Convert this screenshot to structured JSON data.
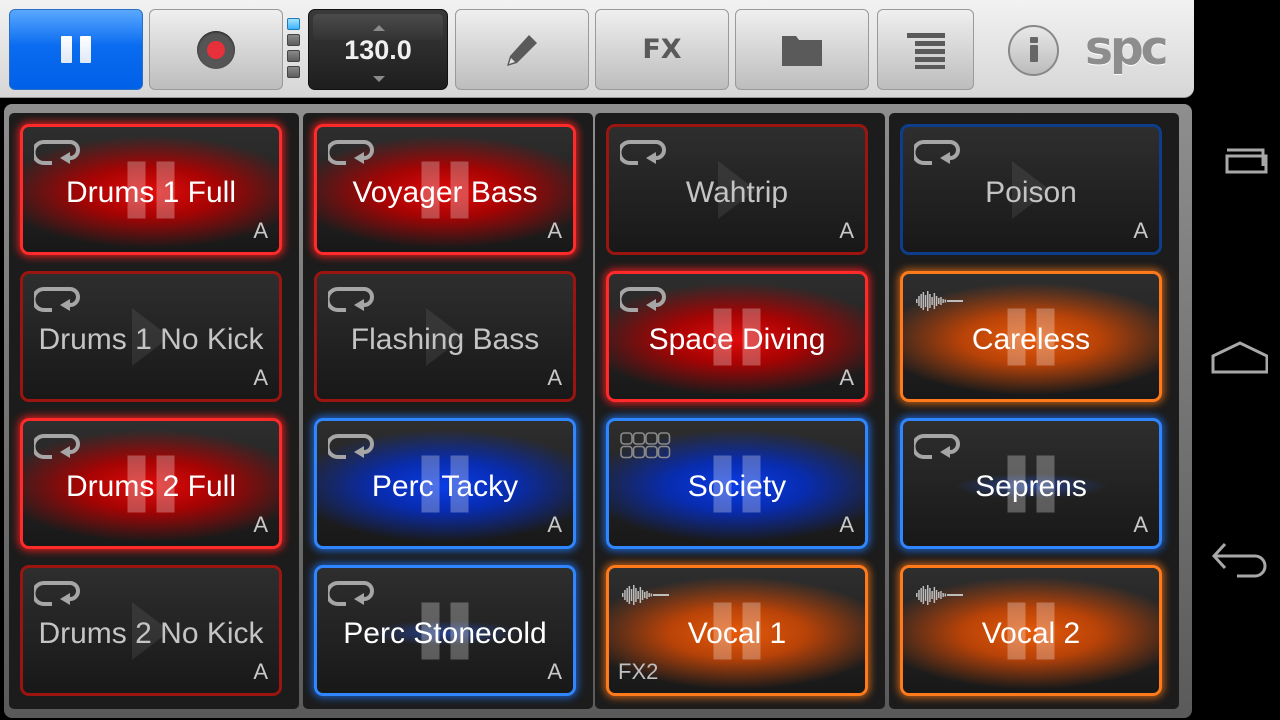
{
  "toolbar": {
    "play_pause": {
      "icon": "pause-icon",
      "state": "playing"
    },
    "record": {
      "icon": "record-icon"
    },
    "banks": [
      {
        "label": "bank-1",
        "active": true
      },
      {
        "label": "bank-2",
        "active": false
      },
      {
        "label": "bank-3",
        "active": false
      },
      {
        "label": "bank-4",
        "active": false
      }
    ],
    "tempo": "130.0",
    "edit": {
      "icon": "pencil-icon"
    },
    "fx_label": "FX",
    "folder": {
      "icon": "folder-icon"
    },
    "menu": {
      "icon": "list-menu-icon"
    },
    "info": {
      "icon": "info-icon"
    },
    "logo": "spc"
  },
  "colors": {
    "red": "#ff2a2a",
    "blue": "#2f86ff",
    "orange": "#ff7a1a",
    "play_button": "#0a6cf0"
  },
  "columns": [
    {
      "pads": [
        {
          "name": "Drums 1 Full",
          "tag": "A",
          "mode": "loop",
          "state": "playing",
          "color": "red"
        },
        {
          "name": "Drums 1 No Kick",
          "tag": "A",
          "mode": "loop",
          "state": "stopped",
          "color": "red"
        },
        {
          "name": "Drums 2 Full",
          "tag": "A",
          "mode": "loop",
          "state": "playing",
          "color": "red"
        },
        {
          "name": "Drums 2 No Kick",
          "tag": "A",
          "mode": "loop",
          "state": "stopped",
          "color": "red"
        }
      ]
    },
    {
      "pads": [
        {
          "name": "Voyager Bass",
          "tag": "A",
          "mode": "loop",
          "state": "playing",
          "color": "red"
        },
        {
          "name": "Flashing Bass",
          "tag": "A",
          "mode": "loop",
          "state": "stopped",
          "color": "red"
        },
        {
          "name": "Perc Tacky",
          "tag": "A",
          "mode": "loop",
          "state": "playing",
          "color": "blue"
        },
        {
          "name": "Perc Stonecold",
          "tag": "A",
          "mode": "loop",
          "state": "playing-dim",
          "color": "blue"
        }
      ]
    },
    {
      "pads": [
        {
          "name": "Wahtrip",
          "tag": "A",
          "mode": "loop",
          "state": "stopped",
          "color": "red"
        },
        {
          "name": "Space Diving",
          "tag": "A",
          "mode": "loop",
          "state": "playing",
          "color": "red"
        },
        {
          "name": "Society",
          "tag": "A",
          "mode": "sequence",
          "state": "playing",
          "color": "blue"
        },
        {
          "name": "Vocal 1",
          "tag": "FX2",
          "tag_position": "left",
          "mode": "one-shot",
          "state": "playing",
          "color": "orange"
        }
      ]
    },
    {
      "pads": [
        {
          "name": "Poison",
          "tag": "A",
          "mode": "loop",
          "state": "stopped",
          "color": "blue"
        },
        {
          "name": "Careless",
          "tag": "",
          "mode": "one-shot",
          "state": "playing",
          "color": "orange"
        },
        {
          "name": "Seprens",
          "tag": "A",
          "mode": "loop",
          "state": "playing-dim",
          "color": "blue"
        },
        {
          "name": "Vocal 2",
          "tag": "",
          "mode": "one-shot",
          "state": "playing",
          "color": "orange"
        }
      ]
    }
  ],
  "android_nav": [
    {
      "name": "recent-apps",
      "icon": "recent-apps-icon"
    },
    {
      "name": "home",
      "icon": "home-icon"
    },
    {
      "name": "back",
      "icon": "back-icon"
    }
  ]
}
